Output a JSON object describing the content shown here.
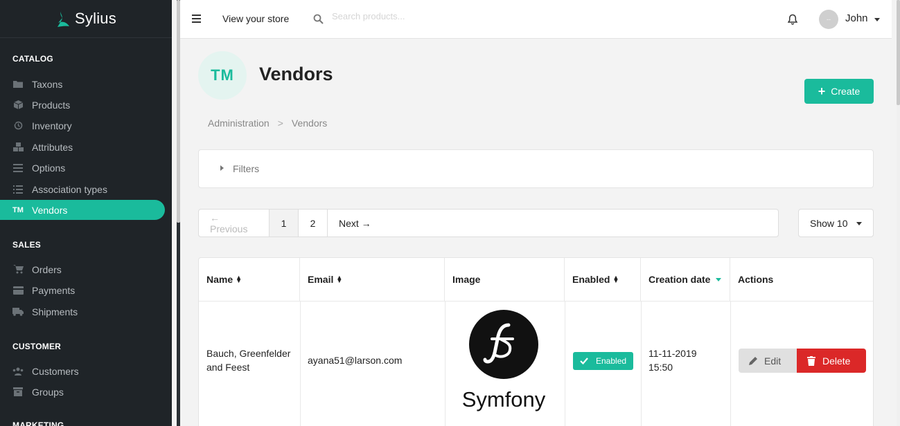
{
  "sidebar": {
    "brand": "Sylius",
    "sections": [
      {
        "title": "CATALOG"
      },
      {
        "title": "SALES"
      },
      {
        "title": "CUSTOMER"
      },
      {
        "title": "MARKETING"
      }
    ],
    "catalog": [
      {
        "label": "Taxons",
        "icon": "folder-icon"
      },
      {
        "label": "Products",
        "icon": "cube-icon"
      },
      {
        "label": "Inventory",
        "icon": "history-icon"
      },
      {
        "label": "Attributes",
        "icon": "cubes-icon"
      },
      {
        "label": "Options",
        "icon": "options-icon"
      },
      {
        "label": "Association types",
        "icon": "list-icon"
      },
      {
        "label": "Vendors",
        "icon": "trademark-icon",
        "icon_text": "TM"
      }
    ],
    "sales": [
      {
        "label": "Orders",
        "icon": "cart-icon"
      },
      {
        "label": "Payments",
        "icon": "payment-icon"
      },
      {
        "label": "Shipments",
        "icon": "truck-icon"
      }
    ],
    "customer": [
      {
        "label": "Customers",
        "icon": "users-icon"
      },
      {
        "label": "Groups",
        "icon": "archive-icon"
      }
    ]
  },
  "topbar": {
    "view_store": "View your store",
    "search_placeholder": "Search products...",
    "user_name": "John",
    "avatar_text": "--"
  },
  "header": {
    "badge": "TM",
    "title": "Vendors",
    "create_label": "Create"
  },
  "breadcrumb": [
    "Administration",
    "Vendors"
  ],
  "filters": {
    "label": "Filters"
  },
  "pagination": {
    "previous": "← Previous",
    "pages": [
      "1",
      "2"
    ],
    "current": "1",
    "next": "Next →",
    "show": "Show 10"
  },
  "table": {
    "columns": [
      "Name",
      "Email",
      "Image",
      "Enabled",
      "Creation date",
      "Actions"
    ],
    "rows": [
      {
        "name_line1": "Bauch, Greenfelder",
        "name_line2": "and Feest",
        "email": "ayana51@larson.com",
        "image": "Symfony",
        "enabled": "Enabled",
        "date_line1": "11-11-2019",
        "date_line2": "15:50",
        "edit": "Edit",
        "delete": "Delete"
      }
    ]
  },
  "colors": {
    "accent": "#1abb9c",
    "danger": "#db2828",
    "sidebar_bg": "#1f2428"
  }
}
